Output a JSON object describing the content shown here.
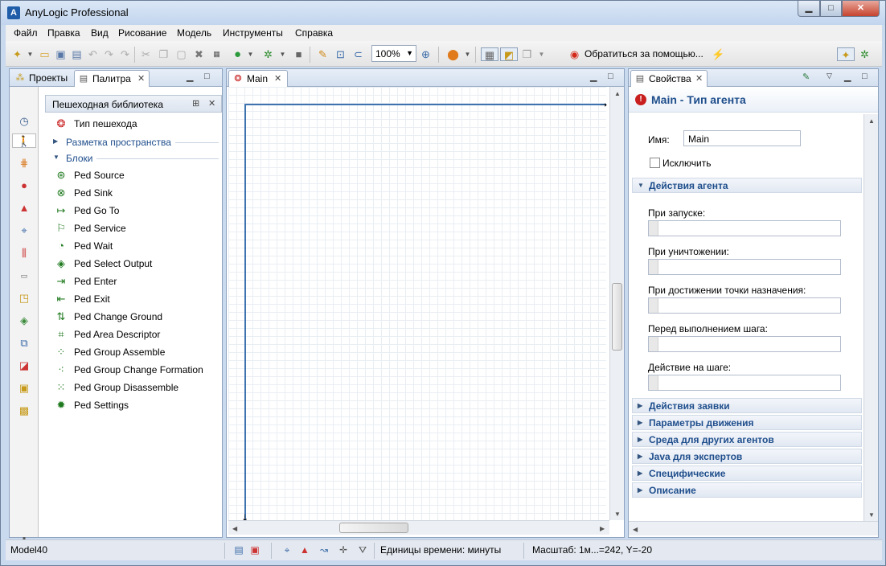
{
  "window": {
    "title": "AnyLogic Professional",
    "logo_letter": "A",
    "minimize": "▁",
    "maximize": "□",
    "close": "✕"
  },
  "menu": [
    "Файл",
    "Правка",
    "Вид",
    "Рисование",
    "Модель",
    "Инструменты",
    "Справка"
  ],
  "toolbar": {
    "zoom": "100%",
    "help": "Обратиться за помощью..."
  },
  "left_panel": {
    "tabs": [
      {
        "label": "Проекты",
        "icon": "projects-icon"
      },
      {
        "label": "Палитра",
        "icon": "palette-icon"
      }
    ],
    "library_title": "Пешеходная библиотека",
    "agent_type": "Тип пешехода",
    "section_space": "Разметка пространства",
    "section_blocks": "Блоки",
    "blocks": [
      "Ped Source",
      "Ped Sink",
      "Ped Go To",
      "Ped Service",
      "Ped Wait",
      "Ped Select Output",
      "Ped Enter",
      "Ped Exit",
      "Ped Change Ground",
      "Ped Area Descriptor",
      "Ped Group Assemble",
      "Ped Group Change Formation",
      "Ped Group Disassemble",
      "Ped Settings"
    ]
  },
  "editor": {
    "tab": "Main"
  },
  "properties": {
    "tab": "Свойства",
    "title": "Main - Тип агента",
    "name_label": "Имя:",
    "name_value": "Main",
    "exclude_label": "Исключить",
    "group_open": "Действия агента",
    "fields": [
      "При запуске:",
      "При уничтожении:",
      "При достижении точки назначения:",
      "Перед выполнением шага:",
      "Действие на шаге:"
    ],
    "groups": [
      "Действия заявки",
      "Параметры движения",
      "Среда для других агентов",
      "Java для экспертов",
      "Специфические",
      "Описание"
    ]
  },
  "status": {
    "model": "Model40",
    "time_units": "Единицы времени: минуты",
    "scale": "Масштаб: 1м...=242, Y=-20"
  }
}
